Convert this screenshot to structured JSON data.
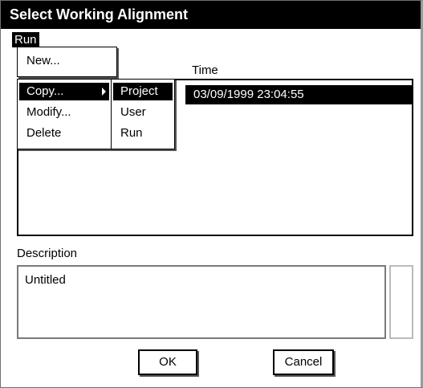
{
  "window": {
    "title": "Select Working Alignment"
  },
  "menubar": {
    "run_label": "Run"
  },
  "run_menu": {
    "new_label": "New...",
    "copy_label": "Copy...",
    "modify_label": "Modify...",
    "delete_label": "Delete"
  },
  "copy_submenu": {
    "items": [
      "Project",
      "User",
      "Run"
    ]
  },
  "list": {
    "time_header": "Time",
    "rows": [
      {
        "time": "03/09/1999 23:04:55",
        "selected": true
      }
    ]
  },
  "description": {
    "label": "Description",
    "value": "Untitled"
  },
  "buttons": {
    "ok_label": "OK",
    "cancel_label": "Cancel"
  },
  "colors": {
    "highlight": "#000000",
    "highlight_text": "#ffffff",
    "background": "#ffffff"
  }
}
